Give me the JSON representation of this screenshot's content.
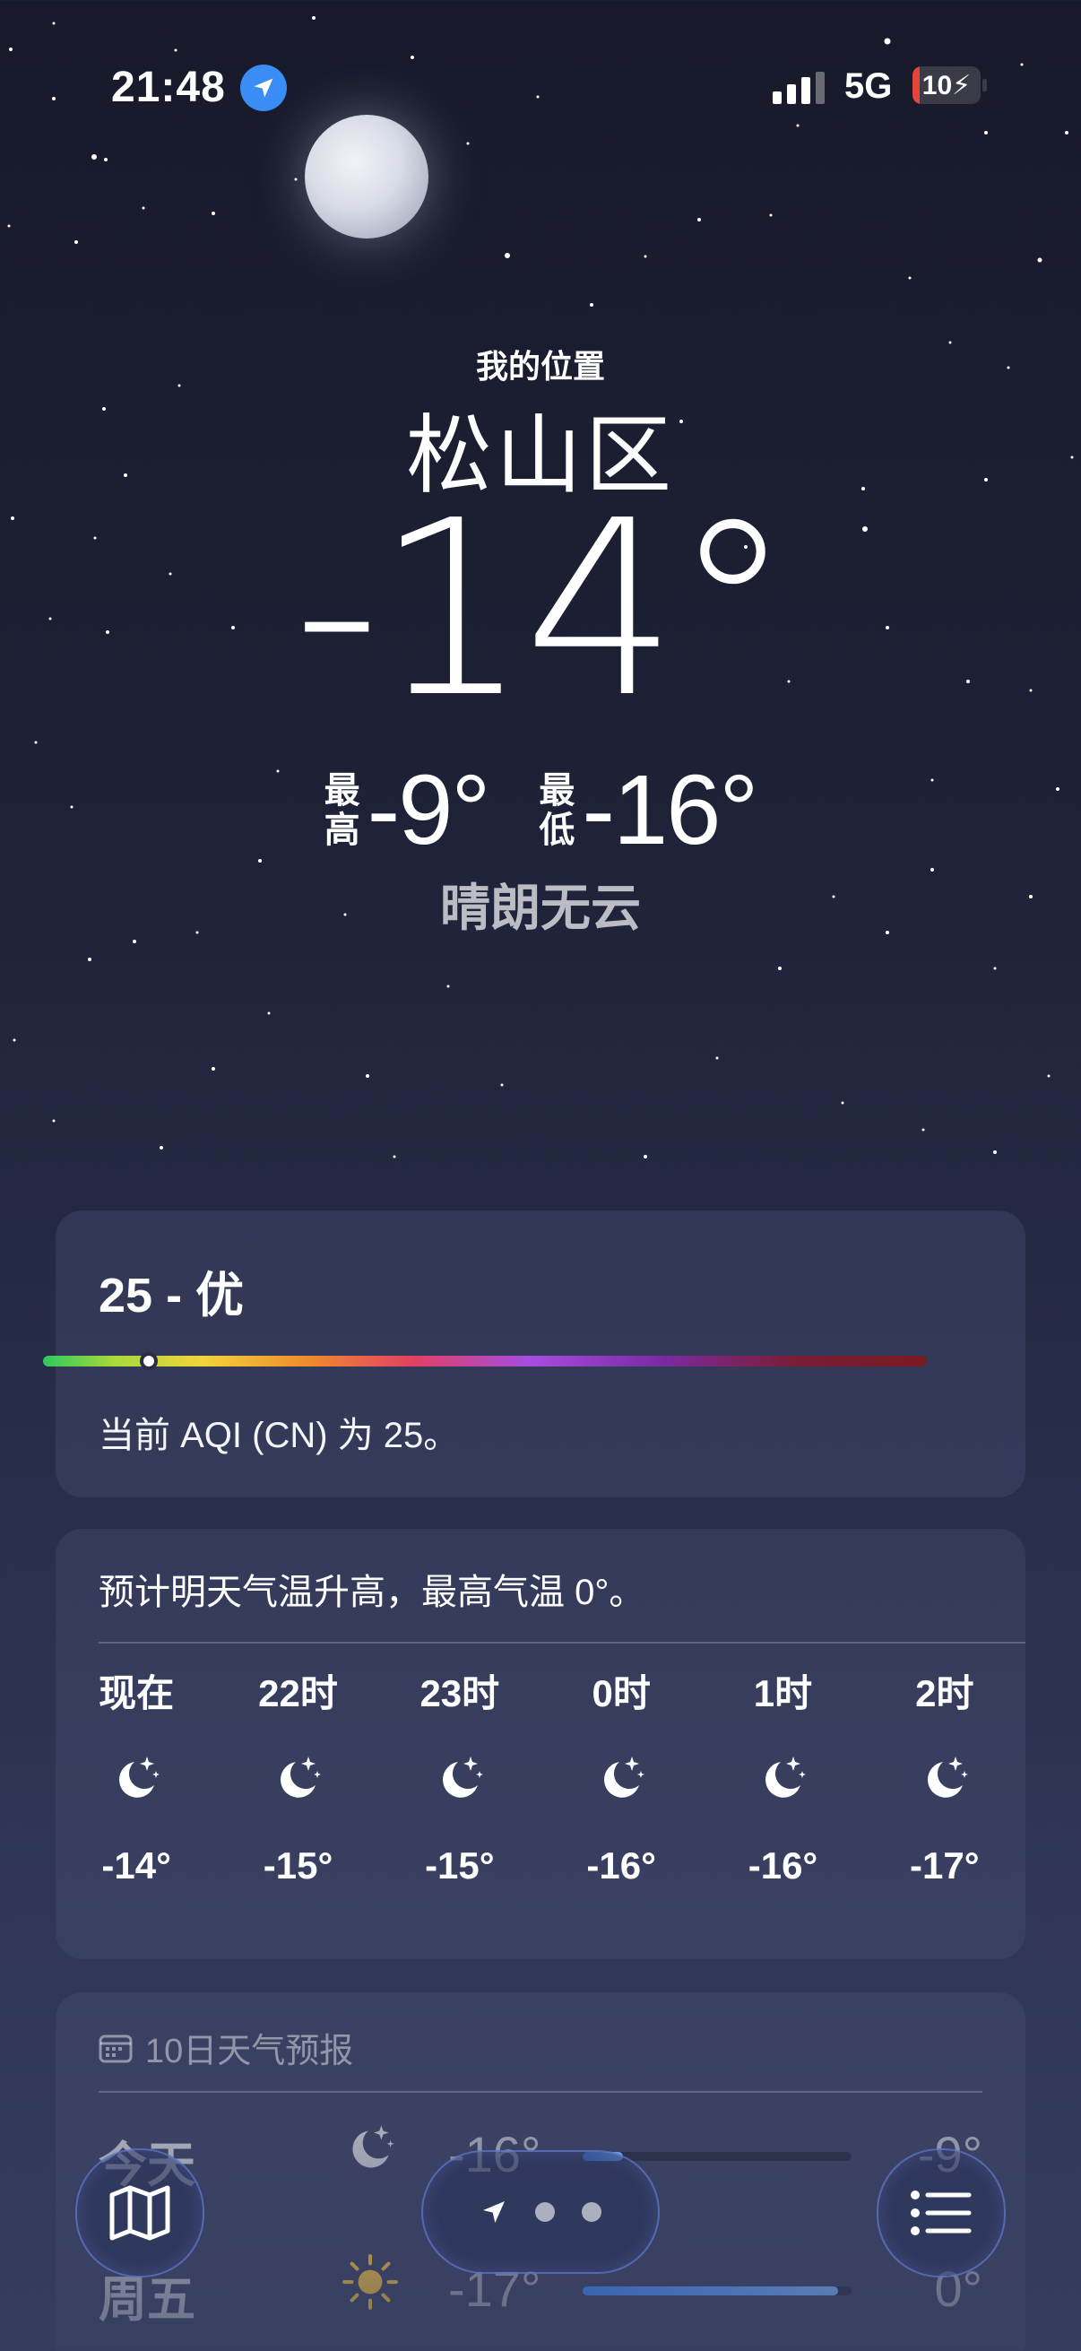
{
  "status_bar": {
    "time": "21:48",
    "network": "5G",
    "battery": "10",
    "battery_level": 0.1,
    "icons": [
      "location-arrow-icon",
      "signal-icon",
      "battery-icon"
    ]
  },
  "hero": {
    "my_location_label": "我的位置",
    "city": "松山区",
    "temperature": "-14°",
    "high_label_top": "最",
    "high_label_bottom": "高",
    "high": "-9°",
    "low_label_top": "最",
    "low_label_bottom": "低",
    "low": "-16°",
    "condition": "晴朗无云"
  },
  "aqi": {
    "value_text": "25 - 优",
    "description": "当前 AQI (CN) 为 25。",
    "level": 0.09
  },
  "hourly": {
    "note": "预计明天气温升高，最高气温 0°。",
    "items": [
      {
        "time": "现在",
        "icon": "moon-stars-icon",
        "temp": "-14°"
      },
      {
        "time": "22时",
        "icon": "moon-stars-icon",
        "temp": "-15°"
      },
      {
        "time": "23时",
        "icon": "moon-stars-icon",
        "temp": "-15°"
      },
      {
        "time": "0时",
        "icon": "moon-stars-icon",
        "temp": "-16°"
      },
      {
        "time": "1时",
        "icon": "moon-stars-icon",
        "temp": "-16°"
      },
      {
        "time": "2时",
        "icon": "moon-stars-icon",
        "temp": "-17°"
      }
    ]
  },
  "ten_day": {
    "header": "10日天气预报",
    "days": [
      {
        "day": "今天",
        "icon": "moon-stars-icon",
        "low": "-16°",
        "high": "-9°"
      },
      {
        "day": "周五",
        "icon": "sun-icon",
        "low": "-17°",
        "high": "0°"
      }
    ]
  },
  "tab_bar": {
    "map_icon": "map-icon",
    "location_icon": "location-arrow-icon",
    "list_icon": "list-icon"
  },
  "colors": {
    "accent": "#3a8df5",
    "battery_low": "#e5443a"
  }
}
